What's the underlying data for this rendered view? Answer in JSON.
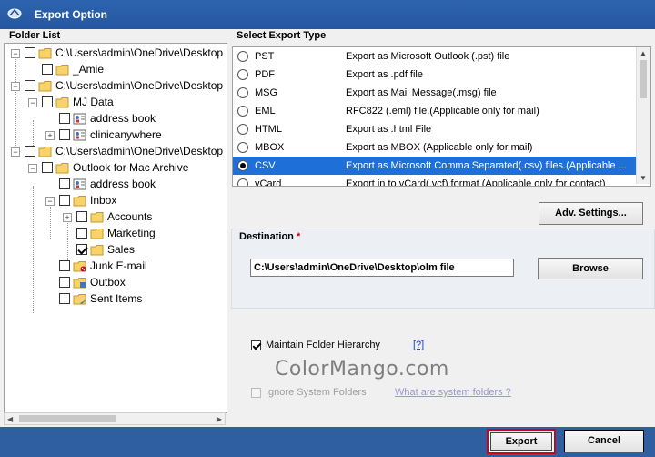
{
  "window": {
    "title": "Export Option"
  },
  "folder_list": {
    "heading": "Folder List",
    "nodes": [
      {
        "label": "C:\\Users\\admin\\OneDrive\\Desktop",
        "checked": false,
        "expander": "−",
        "folder": "yellow"
      },
      {
        "label": "_Amie",
        "checked": false,
        "expander": "",
        "folder": "yellow"
      },
      {
        "label": "C:\\Users\\admin\\OneDrive\\Desktop",
        "checked": false,
        "expander": "−",
        "folder": "yellow"
      },
      {
        "label": "MJ Data",
        "checked": false,
        "expander": "−",
        "folder": "yellow"
      },
      {
        "label": "address book",
        "checked": false,
        "expander": "",
        "folder": "contacts"
      },
      {
        "label": "clinicanywhere",
        "checked": false,
        "expander": "+",
        "folder": "contacts"
      },
      {
        "label": "C:\\Users\\admin\\OneDrive\\Desktop",
        "checked": false,
        "expander": "−",
        "folder": "yellow"
      },
      {
        "label": "Outlook for Mac Archive",
        "checked": false,
        "expander": "−",
        "folder": "yellow"
      },
      {
        "label": "address book",
        "checked": false,
        "expander": "",
        "folder": "contacts"
      },
      {
        "label": "Inbox",
        "checked": false,
        "expander": "−",
        "folder": "inbox"
      },
      {
        "label": "Accounts",
        "checked": false,
        "expander": "+",
        "folder": "yellow"
      },
      {
        "label": "Marketing",
        "checked": false,
        "expander": "",
        "folder": "yellow"
      },
      {
        "label": "Sales",
        "checked": true,
        "expander": "",
        "folder": "yellow"
      },
      {
        "label": "Junk E-mail",
        "checked": false,
        "expander": "",
        "folder": "junk"
      },
      {
        "label": "Outbox",
        "checked": false,
        "expander": "",
        "folder": "outbox"
      },
      {
        "label": "Sent Items",
        "checked": false,
        "expander": "",
        "folder": "sent"
      }
    ]
  },
  "export_type": {
    "heading": "Select Export Type",
    "options": [
      {
        "name": "PST",
        "description": "Export as Microsoft Outlook (.pst) file",
        "selected": false
      },
      {
        "name": "PDF",
        "description": "Export as .pdf file",
        "selected": false
      },
      {
        "name": "MSG",
        "description": "Export as Mail Message(.msg) file",
        "selected": false
      },
      {
        "name": "EML",
        "description": "RFC822 (.eml) file.(Applicable only for mail)",
        "selected": false
      },
      {
        "name": "HTML",
        "description": "Export as .html File",
        "selected": false
      },
      {
        "name": "MBOX",
        "description": "Export as MBOX (Applicable only for mail)",
        "selected": false
      },
      {
        "name": "CSV",
        "description": "Export as Microsoft Comma Separated(.csv) files.(Applicable ...",
        "selected": true
      },
      {
        "name": "vCard",
        "description": "Export in to vCard(.vcf) format (Applicable only for contact)",
        "selected": false
      }
    ],
    "adv_settings_label": "Adv. Settings..."
  },
  "destination": {
    "label": "Destination",
    "required_mark": "*",
    "path": "C:\\Users\\admin\\OneDrive\\Desktop\\olm file",
    "browse_label": "Browse"
  },
  "options": {
    "maintain_hierarchy_label": "Maintain Folder Hierarchy",
    "maintain_hierarchy_checked": true,
    "help_link": "[?]",
    "ignore_system_label": "Ignore System Folders",
    "ignore_system_checked": false,
    "system_folders_link": "What are system folders ?"
  },
  "watermark": "ColorMango.com",
  "buttons": {
    "export_label": "Export",
    "cancel_label": "Cancel"
  },
  "colors": {
    "title_bar": "#2557a0",
    "selection": "#1f6fd8",
    "export_outline": "#d0021b",
    "bottom_bar": "#2f5fa0"
  }
}
